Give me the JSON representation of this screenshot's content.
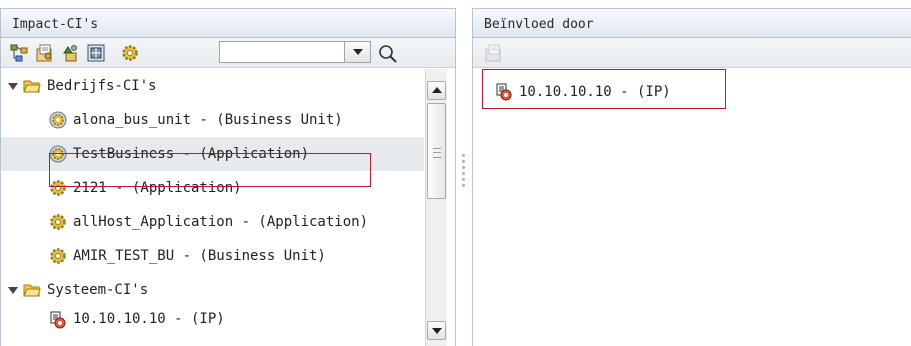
{
  "left_panel": {
    "title": "Impact-CI's",
    "toolbar": {
      "buttons": [
        "hierarchy-icon",
        "properties-icon",
        "move-up-icon",
        "map-icon",
        "settings-gear-icon"
      ],
      "filter_value": "",
      "search_icon": "search-icon"
    },
    "tree": [
      {
        "label": "Bedrijfs-CI's",
        "type": "folder",
        "level": 0,
        "expanded": true
      },
      {
        "label": "alona_bus_unit - (Business Unit)",
        "icon": "business-unit-icon",
        "level": 1
      },
      {
        "label": "TestBusiness - (Application)",
        "icon": "business-unit-icon",
        "level": 1,
        "selected": true
      },
      {
        "label": "2121 - (Application)",
        "icon": "gear-icon",
        "level": 1
      },
      {
        "label": "allHost_Application - (Application)",
        "icon": "gear-icon",
        "level": 1
      },
      {
        "label": "AMIR_TEST_BU - (Business Unit)",
        "icon": "gear-icon",
        "level": 1
      },
      {
        "label": "Systeem-CI's",
        "type": "folder",
        "level": 0,
        "expanded": true
      },
      {
        "label": "10.10.10.10 - (IP)",
        "icon": "ip-address-icon",
        "level": 1
      }
    ]
  },
  "right_panel": {
    "title": "Beïnvloed door",
    "toolbar": {
      "buttons": [
        "properties-icon"
      ]
    },
    "items": [
      {
        "label": "10.10.10.10 - (IP)",
        "icon": "ip-address-icon",
        "highlighted": true
      }
    ]
  },
  "colors": {
    "highlight_border": "#b31d2c",
    "selected_row": "#e6eaee",
    "header_bg": "#dfe7ef"
  }
}
